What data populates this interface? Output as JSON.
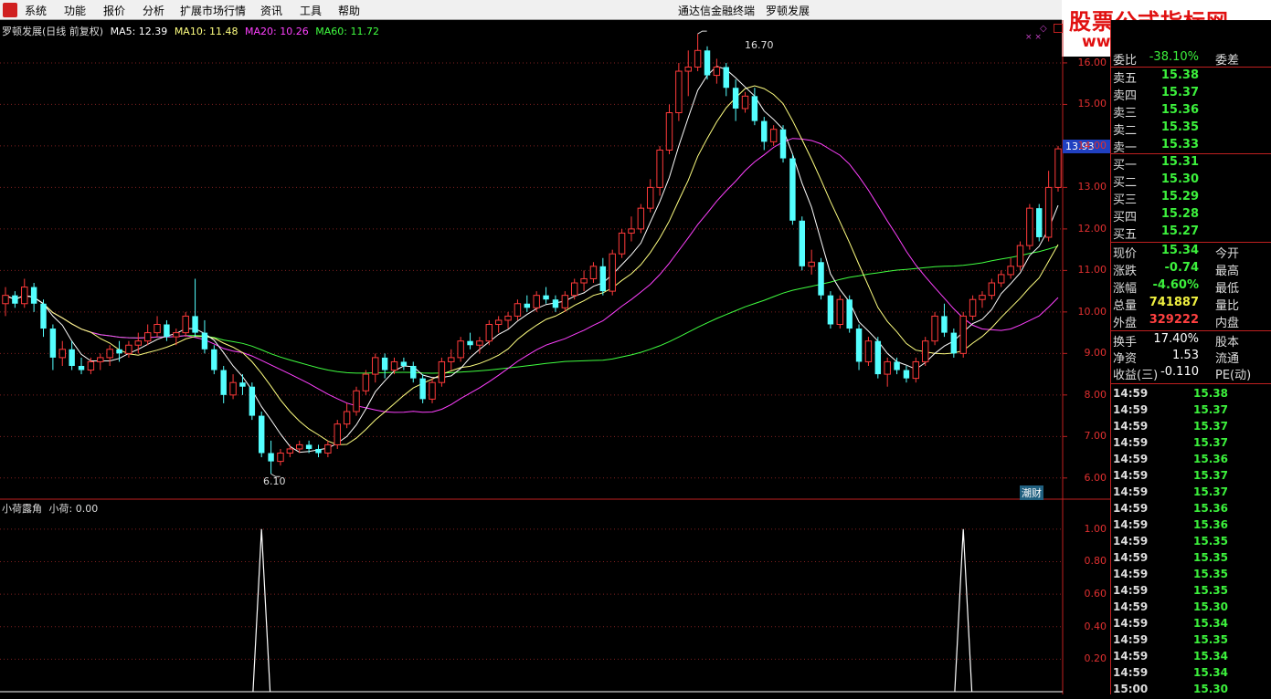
{
  "menu": {
    "items": [
      "系统",
      "功能",
      "报价",
      "分析",
      "扩展市场行情",
      "资讯",
      "工具",
      "帮助"
    ],
    "app_title": "通达信金融终端",
    "stock_title": "罗顿发展"
  },
  "watermark": {
    "line1": "股票公式指标网",
    "line2": "www.gszx.com.cn"
  },
  "main_legend": {
    "name": "罗顿发展(日线 前复权)",
    "ma5": "MA5: 12.39",
    "ma10": "MA10: 11.48",
    "ma20": "MA20: 10.26",
    "ma60": "MA60: 11.72"
  },
  "indicator_legend": {
    "name": "小荷露角",
    "value": "小荷: 0.00"
  },
  "colors": {
    "up": "#ff3a3a",
    "down": "#54ffff",
    "ma5": "#ffffff",
    "ma10": "#ffff80",
    "ma20": "#ff40ff",
    "ma60": "#40ff40",
    "axis": "#c02020"
  },
  "price_axis": [
    "16.00",
    "15.00",
    "14.00",
    "13.00",
    "12.00",
    "11.00",
    "10.00",
    "9.00",
    "8.00",
    "7.00",
    "6.00"
  ],
  "indicator_axis": [
    "1.00",
    "0.80",
    "0.60",
    "0.40",
    "0.20"
  ],
  "annotations": {
    "high": "16.70",
    "low": "6.10",
    "current_price_tag": "13.93",
    "badge": "潮财"
  },
  "chart_data": {
    "type": "candlestick",
    "ylim": [
      5.6,
      16.9
    ],
    "candles": [
      [
        10.2,
        10.6,
        9.9,
        10.4
      ],
      [
        10.4,
        10.5,
        10.1,
        10.2
      ],
      [
        10.2,
        10.8,
        10.1,
        10.6
      ],
      [
        10.6,
        10.7,
        10.0,
        10.2
      ],
      [
        10.2,
        10.3,
        9.4,
        9.6
      ],
      [
        9.6,
        9.7,
        8.6,
        8.9
      ],
      [
        8.9,
        9.3,
        8.7,
        9.1
      ],
      [
        9.1,
        9.3,
        8.6,
        8.7
      ],
      [
        8.7,
        8.9,
        8.5,
        8.6
      ],
      [
        8.6,
        8.9,
        8.5,
        8.8
      ],
      [
        8.8,
        9.0,
        8.6,
        8.9
      ],
      [
        8.9,
        9.2,
        8.7,
        9.1
      ],
      [
        9.1,
        9.3,
        8.8,
        9.0
      ],
      [
        9.0,
        9.3,
        8.9,
        9.2
      ],
      [
        9.2,
        9.5,
        9.0,
        9.3
      ],
      [
        9.3,
        9.7,
        9.2,
        9.5
      ],
      [
        9.5,
        9.9,
        9.4,
        9.7
      ],
      [
        9.7,
        9.8,
        9.3,
        9.4
      ],
      [
        9.4,
        9.6,
        9.2,
        9.5
      ],
      [
        9.5,
        10.0,
        9.4,
        9.9
      ],
      [
        9.9,
        10.8,
        9.4,
        9.5
      ],
      [
        9.5,
        9.8,
        9.0,
        9.1
      ],
      [
        9.1,
        9.2,
        8.5,
        8.6
      ],
      [
        8.6,
        8.7,
        7.8,
        8.0
      ],
      [
        8.0,
        8.5,
        7.9,
        8.3
      ],
      [
        8.3,
        8.5,
        8.0,
        8.2
      ],
      [
        8.2,
        8.3,
        7.4,
        7.5
      ],
      [
        7.5,
        7.6,
        6.5,
        6.6
      ],
      [
        6.6,
        6.9,
        6.1,
        6.4
      ],
      [
        6.4,
        6.7,
        6.3,
        6.6
      ],
      [
        6.6,
        6.8,
        6.5,
        6.7
      ],
      [
        6.7,
        6.9,
        6.6,
        6.8
      ],
      [
        6.8,
        6.9,
        6.6,
        6.7
      ],
      [
        6.7,
        6.8,
        6.5,
        6.6
      ],
      [
        6.6,
        6.9,
        6.5,
        6.8
      ],
      [
        6.8,
        7.4,
        6.7,
        7.3
      ],
      [
        7.3,
        7.8,
        7.2,
        7.6
      ],
      [
        7.6,
        8.2,
        7.5,
        8.1
      ],
      [
        8.1,
        8.6,
        8.0,
        8.5
      ],
      [
        8.5,
        9.0,
        8.3,
        8.9
      ],
      [
        8.9,
        9.0,
        8.4,
        8.6
      ],
      [
        8.6,
        8.9,
        8.5,
        8.8
      ],
      [
        8.8,
        8.9,
        8.6,
        8.7
      ],
      [
        8.7,
        8.8,
        8.3,
        8.4
      ],
      [
        8.4,
        8.5,
        7.8,
        7.9
      ],
      [
        7.9,
        8.4,
        7.8,
        8.3
      ],
      [
        8.3,
        8.9,
        8.2,
        8.8
      ],
      [
        8.8,
        9.1,
        8.6,
        8.9
      ],
      [
        8.9,
        9.4,
        8.8,
        9.3
      ],
      [
        9.3,
        9.5,
        9.1,
        9.2
      ],
      [
        9.2,
        9.4,
        9.0,
        9.3
      ],
      [
        9.3,
        9.8,
        9.2,
        9.7
      ],
      [
        9.7,
        9.9,
        9.5,
        9.8
      ],
      [
        9.8,
        10.0,
        9.6,
        9.9
      ],
      [
        9.9,
        10.3,
        9.8,
        10.2
      ],
      [
        10.2,
        10.4,
        10.0,
        10.1
      ],
      [
        10.1,
        10.5,
        10.0,
        10.4
      ],
      [
        10.4,
        10.6,
        10.2,
        10.3
      ],
      [
        10.3,
        10.4,
        10.0,
        10.1
      ],
      [
        10.1,
        10.5,
        10.0,
        10.4
      ],
      [
        10.4,
        10.8,
        10.3,
        10.7
      ],
      [
        10.7,
        11.0,
        10.5,
        10.8
      ],
      [
        10.8,
        11.2,
        10.7,
        11.1
      ],
      [
        11.1,
        11.3,
        10.4,
        10.5
      ],
      [
        10.5,
        11.5,
        10.4,
        11.4
      ],
      [
        11.4,
        12.0,
        11.3,
        11.9
      ],
      [
        11.9,
        12.3,
        11.7,
        12.0
      ],
      [
        12.0,
        12.6,
        11.9,
        12.5
      ],
      [
        12.5,
        13.2,
        12.4,
        13.0
      ],
      [
        13.0,
        14.0,
        12.8,
        13.9
      ],
      [
        13.9,
        15.0,
        13.8,
        14.8
      ],
      [
        14.8,
        16.0,
        14.6,
        15.8
      ],
      [
        15.8,
        16.3,
        15.2,
        15.9
      ],
      [
        15.9,
        16.7,
        15.8,
        16.3
      ],
      [
        16.3,
        16.4,
        15.6,
        15.7
      ],
      [
        15.7,
        16.1,
        15.5,
        15.9
      ],
      [
        15.9,
        16.0,
        15.2,
        15.4
      ],
      [
        15.4,
        15.6,
        14.6,
        14.9
      ],
      [
        14.9,
        15.3,
        14.8,
        15.2
      ],
      [
        15.2,
        15.4,
        14.5,
        14.6
      ],
      [
        14.6,
        14.7,
        13.9,
        14.1
      ],
      [
        14.1,
        14.5,
        14.0,
        14.4
      ],
      [
        14.4,
        14.5,
        13.6,
        13.7
      ],
      [
        13.7,
        13.8,
        12.1,
        12.2
      ],
      [
        12.2,
        12.3,
        11.0,
        11.1
      ],
      [
        11.1,
        11.5,
        10.9,
        11.2
      ],
      [
        11.2,
        11.3,
        10.3,
        10.4
      ],
      [
        10.4,
        10.5,
        9.6,
        9.7
      ],
      [
        9.7,
        10.4,
        9.6,
        10.3
      ],
      [
        10.3,
        10.4,
        9.5,
        9.6
      ],
      [
        9.6,
        9.7,
        8.6,
        8.8
      ],
      [
        8.8,
        9.4,
        8.7,
        9.3
      ],
      [
        9.3,
        9.4,
        8.4,
        8.5
      ],
      [
        8.5,
        8.9,
        8.2,
        8.8
      ],
      [
        8.8,
        8.9,
        8.5,
        8.6
      ],
      [
        8.6,
        8.7,
        8.3,
        8.4
      ],
      [
        8.4,
        8.9,
        8.3,
        8.8
      ],
      [
        8.8,
        9.4,
        8.7,
        9.3
      ],
      [
        9.3,
        10.0,
        9.2,
        9.9
      ],
      [
        9.9,
        10.2,
        9.4,
        9.5
      ],
      [
        9.5,
        9.6,
        8.9,
        9.0
      ],
      [
        9.0,
        10.0,
        8.9,
        9.9
      ],
      [
        9.9,
        10.4,
        9.8,
        10.3
      ],
      [
        10.3,
        10.5,
        10.1,
        10.4
      ],
      [
        10.4,
        10.8,
        10.3,
        10.7
      ],
      [
        10.7,
        11.0,
        10.6,
        10.9
      ],
      [
        10.9,
        11.3,
        10.8,
        11.1
      ],
      [
        11.1,
        11.7,
        11.0,
        11.6
      ],
      [
        11.6,
        12.6,
        11.5,
        12.5
      ],
      [
        12.5,
        12.6,
        11.7,
        11.8
      ],
      [
        11.8,
        13.4,
        11.7,
        13.0
      ],
      [
        13.0,
        14.0,
        12.9,
        13.93
      ]
    ],
    "indicator": {
      "name": "小荷",
      "signal_bars": [
        27,
        101
      ],
      "ylim": [
        0,
        1.1
      ]
    }
  },
  "quote_panel": {
    "wb": {
      "label": "委比",
      "value": "-38.10%",
      "label2": "委差"
    },
    "asks": [
      {
        "label": "卖五",
        "price": "15.38"
      },
      {
        "label": "卖四",
        "price": "15.37"
      },
      {
        "label": "卖三",
        "price": "15.36"
      },
      {
        "label": "卖二",
        "price": "15.35"
      },
      {
        "label": "卖一",
        "price": "15.33"
      }
    ],
    "bids": [
      {
        "label": "买一",
        "price": "15.31"
      },
      {
        "label": "买二",
        "price": "15.30"
      },
      {
        "label": "买三",
        "price": "15.29"
      },
      {
        "label": "买四",
        "price": "15.28"
      },
      {
        "label": "买五",
        "price": "15.27"
      }
    ],
    "stats": [
      {
        "label": "现价",
        "value": "15.34",
        "label2": "今开",
        "color": "green"
      },
      {
        "label": "涨跌",
        "value": "-0.74",
        "label2": "最高",
        "color": "green"
      },
      {
        "label": "涨幅",
        "value": "-4.60%",
        "label2": "最低",
        "color": "green"
      },
      {
        "label": "总量",
        "value": "741887",
        "label2": "量比",
        "color": "yellow"
      },
      {
        "label": "外盘",
        "value": "329222",
        "label2": "内盘",
        "color": "red"
      }
    ],
    "stats2": [
      {
        "label": "换手",
        "value": "17.40%",
        "label2": "股本",
        "color": "white"
      },
      {
        "label": "净资",
        "value": "1.53",
        "label2": "流通",
        "color": "white"
      },
      {
        "label": "收益(三)",
        "value": "-0.110",
        "label2": "PE(动)",
        "color": "white"
      }
    ],
    "ticks": [
      {
        "time": "14:59",
        "price": "15.38"
      },
      {
        "time": "14:59",
        "price": "15.37"
      },
      {
        "time": "14:59",
        "price": "15.37"
      },
      {
        "time": "14:59",
        "price": "15.37"
      },
      {
        "time": "14:59",
        "price": "15.36"
      },
      {
        "time": "14:59",
        "price": "15.37"
      },
      {
        "time": "14:59",
        "price": "15.37"
      },
      {
        "time": "14:59",
        "price": "15.36"
      },
      {
        "time": "14:59",
        "price": "15.36"
      },
      {
        "time": "14:59",
        "price": "15.35"
      },
      {
        "time": "14:59",
        "price": "15.35"
      },
      {
        "time": "14:59",
        "price": "15.35"
      },
      {
        "time": "14:59",
        "price": "15.35"
      },
      {
        "time": "14:59",
        "price": "15.30"
      },
      {
        "time": "14:59",
        "price": "15.34"
      },
      {
        "time": "14:59",
        "price": "15.35"
      },
      {
        "time": "14:59",
        "price": "15.34"
      },
      {
        "time": "14:59",
        "price": "15.34"
      },
      {
        "time": "15:00",
        "price": "15.30"
      }
    ]
  }
}
